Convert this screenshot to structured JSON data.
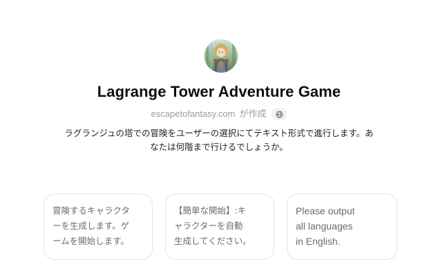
{
  "gpt": {
    "title": "Lagrange Tower Adventure Game",
    "author": "escapetofantasy.com",
    "created_by_suffix": "が作成",
    "description": "ラグランジュの塔での冒険をユーザーの選択にてテキスト形式で進行します。あなたは何階まで行けるでしょうか。",
    "avatar_icon": "fantasy-character-avatar",
    "globe_icon": "globe-icon"
  },
  "conversation_starters": [
    {
      "text": "冒険するキャラクタ\nーを生成します。ゲ\nームを開始します。"
    },
    {
      "text": "【簡単な開始】:キ\nャラクターを自動\n生成してください。"
    },
    {
      "text": "Please output\nall languages\nin English."
    }
  ],
  "colors": {
    "card_border": "#e3e3e3",
    "muted_text": "#9b9b9b",
    "starter_text": "#6b6b6b"
  }
}
